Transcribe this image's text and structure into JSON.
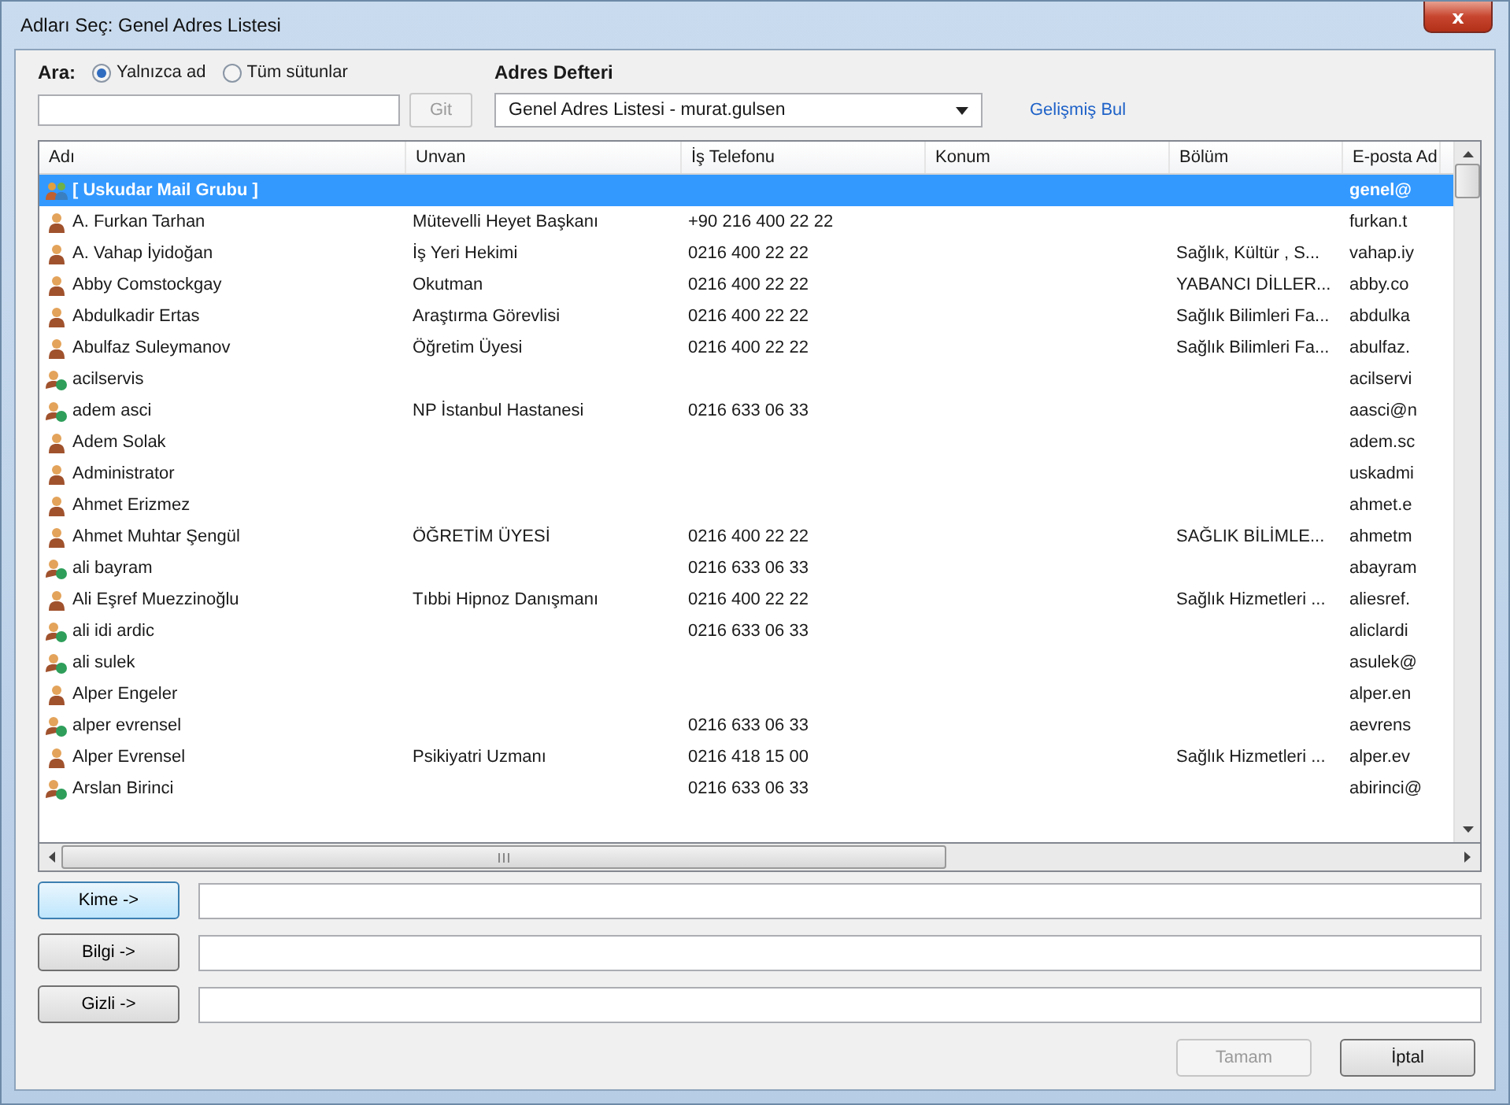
{
  "window": {
    "title": "Adları Seç: Genel Adres Listesi",
    "close": "x"
  },
  "search": {
    "label": "Ara:",
    "options": [
      {
        "label": "Yalnızca ad",
        "selected": true
      },
      {
        "label": "Tüm sütunlar",
        "selected": false
      }
    ],
    "go_button": {
      "label": "Git",
      "disabled": true
    }
  },
  "address_book": {
    "label": "Adres Defteri",
    "value": "Genel Adres Listesi - murat.gulsen",
    "advanced_link": "Gelişmiş Bul"
  },
  "table": {
    "columns": [
      "Adı",
      "Unvan",
      "İş Telefonu",
      "Konum",
      "Bölüm",
      "E-posta Ad"
    ],
    "rows": [
      {
        "kind": "group",
        "selected": true,
        "name": "[ Uskudar Mail Grubu ]",
        "title": "",
        "phone": "",
        "location": "",
        "department": "",
        "email": "genel@"
      },
      {
        "kind": "user",
        "selected": false,
        "name": "A. Furkan Tarhan",
        "title": "Mütevelli Heyet Başkanı",
        "phone": "+90 216 400 22 22",
        "location": "",
        "department": "",
        "email": "furkan.t"
      },
      {
        "kind": "user",
        "selected": false,
        "name": "A. Vahap İyidoğan",
        "title": "İş Yeri Hekimi",
        "phone": "0216 400 22 22",
        "location": "",
        "department": "Sağlık, Kültür , S...",
        "email": "vahap.iy"
      },
      {
        "kind": "user",
        "selected": false,
        "name": "Abby  Comstockgay",
        "title": "Okutman",
        "phone": "0216 400 22 22",
        "location": "",
        "department": "YABANCI DİLLER...",
        "email": "abby.co"
      },
      {
        "kind": "user",
        "selected": false,
        "name": "Abdulkadir Ertas",
        "title": "Araştırma Görevlisi",
        "phone": "0216 400 22 22",
        "location": "",
        "department": "Sağlık Bilimleri Fa...",
        "email": "abdulka"
      },
      {
        "kind": "user",
        "selected": false,
        "name": "Abulfaz Suleymanov",
        "title": "Öğretim Üyesi",
        "phone": "0216 400 22 22",
        "location": "",
        "department": "Sağlık Bilimleri Fa...",
        "email": "abulfaz."
      },
      {
        "kind": "contact",
        "selected": false,
        "name": "acilservis",
        "title": "",
        "phone": "",
        "location": "",
        "department": "",
        "email": "acilservi"
      },
      {
        "kind": "contact",
        "selected": false,
        "name": "adem asci",
        "title": "NP İstanbul Hastanesi",
        "phone": "0216 633 06 33",
        "location": "",
        "department": "",
        "email": "aasci@n"
      },
      {
        "kind": "user",
        "selected": false,
        "name": "Adem Solak",
        "title": "",
        "phone": "",
        "location": "",
        "department": "",
        "email": "adem.sc"
      },
      {
        "kind": "user",
        "selected": false,
        "name": "Administrator",
        "title": "",
        "phone": "",
        "location": "",
        "department": "",
        "email": "uskadmi"
      },
      {
        "kind": "user",
        "selected": false,
        "name": "Ahmet Erizmez",
        "title": "",
        "phone": "",
        "location": "",
        "department": "",
        "email": "ahmet.e"
      },
      {
        "kind": "user",
        "selected": false,
        "name": "Ahmet Muhtar Şengül",
        "title": "ÖĞRETİM ÜYESİ",
        "phone": "0216 400 22 22",
        "location": "",
        "department": "SAĞLIK BİLİMLE...",
        "email": "ahmetm"
      },
      {
        "kind": "contact",
        "selected": false,
        "name": "ali bayram",
        "title": "",
        "phone": "0216 633 06 33",
        "location": "",
        "department": "",
        "email": "abayram"
      },
      {
        "kind": "user",
        "selected": false,
        "name": "Ali Eşref Muezzinoğlu",
        "title": "Tıbbi Hipnoz Danışmanı",
        "phone": "0216 400 22 22",
        "location": "",
        "department": "Sağlık Hizmetleri ...",
        "email": "aliesref."
      },
      {
        "kind": "contact",
        "selected": false,
        "name": "ali idi ardic",
        "title": "",
        "phone": "0216 633 06 33",
        "location": "",
        "department": "",
        "email": "aliclardi"
      },
      {
        "kind": "contact",
        "selected": false,
        "name": "ali sulek",
        "title": "",
        "phone": "",
        "location": "",
        "department": "",
        "email": "asulek@"
      },
      {
        "kind": "user",
        "selected": false,
        "name": "Alper Engeler",
        "title": "",
        "phone": "",
        "location": "",
        "department": "",
        "email": "alper.en"
      },
      {
        "kind": "contact",
        "selected": false,
        "name": "alper evrensel",
        "title": "",
        "phone": "0216 633 06 33",
        "location": "",
        "department": "",
        "email": "aevrens"
      },
      {
        "kind": "user",
        "selected": false,
        "name": "Alper Evrensel",
        "title": "Psikiyatri Uzmanı",
        "phone": "0216 418 15 00",
        "location": "",
        "department": "Sağlık Hizmetleri ...",
        "email": "alper.ev"
      },
      {
        "kind": "contact",
        "selected": false,
        "name": "Arslan Birinci",
        "title": "",
        "phone": "0216 633 06 33",
        "location": "",
        "department": "",
        "email": "abirinci@"
      }
    ]
  },
  "recipients": [
    {
      "label": "Kime ->",
      "focused": true
    },
    {
      "label": "Bilgi ->",
      "focused": false
    },
    {
      "label": "Gizli ->",
      "focused": false
    }
  ],
  "buttons": [
    {
      "label": "Tamam",
      "disabled": true
    },
    {
      "label": "İptal",
      "disabled": false
    }
  ]
}
